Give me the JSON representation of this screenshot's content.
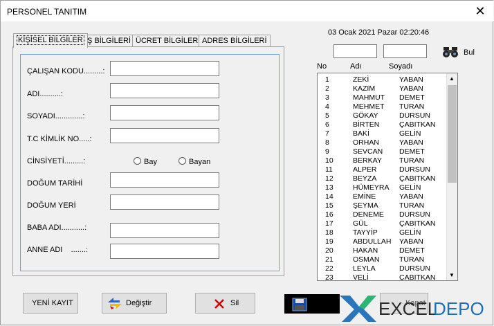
{
  "window": {
    "title": "PERSONEL TANITIM",
    "close_glyph": "✕"
  },
  "tabs": [
    {
      "label": "KİŞİSEL BİLGİLER",
      "active": true
    },
    {
      "label": "İŞ BİLGİLERİ",
      "active": false
    },
    {
      "label": "ÜCRET BİLGİLERİ",
      "active": false
    },
    {
      "label": "ADRES BİLGİLERİ",
      "active": false
    }
  ],
  "form": {
    "calisan_kodu": "ÇALIŞAN KODU.........:",
    "adi": "ADI..........:",
    "soyadi": "SOYADI.............:",
    "tc_kimlik": "T.C KİMLİK NO.....:",
    "cinsiyeti": "CİNSİYETİ.........:",
    "bay": "Bay",
    "bayan": "Bayan",
    "dogum_tarihi": "DOĞUM TARİHİ",
    "dogum_yeri": "DOĞUM YERİ",
    "baba_adi": "BABA ADI...........:",
    "anne_adi": "ANNE ADI    .......:"
  },
  "datetime": "03 Ocak 2021 Pazar 02:20:46",
  "search": {
    "button_label": "Bul"
  },
  "list_headers": {
    "no": "No",
    "adi": "Adı",
    "soyadi": "Soyadı"
  },
  "rows": [
    {
      "no": "1",
      "adi": "ZEKİ",
      "soyadi": "YABAN"
    },
    {
      "no": "2",
      "adi": "KAZIM",
      "soyadi": "YABAN"
    },
    {
      "no": "3",
      "adi": "MAHMUT",
      "soyadi": "DEMET"
    },
    {
      "no": "4",
      "adi": "MEHMET",
      "soyadi": "TURAN"
    },
    {
      "no": "5",
      "adi": "GÖKAY",
      "soyadi": "DURSUN"
    },
    {
      "no": "6",
      "adi": "BİRTEN",
      "soyadi": "ÇABITKAN"
    },
    {
      "no": "7",
      "adi": "BAKİ",
      "soyadi": "GELİN"
    },
    {
      "no": "8",
      "adi": "ORHAN",
      "soyadi": "YABAN"
    },
    {
      "no": "9",
      "adi": "SEVCAN",
      "soyadi": "DEMET"
    },
    {
      "no": "10",
      "adi": "BERKAY",
      "soyadi": "TURAN"
    },
    {
      "no": "11",
      "adi": "ALPER",
      "soyadi": "DURSUN"
    },
    {
      "no": "12",
      "adi": "BEYZA",
      "soyadi": "ÇABITKAN"
    },
    {
      "no": "13",
      "adi": "HÜMEYRA",
      "soyadi": "GELİN"
    },
    {
      "no": "14",
      "adi": "EMİNE",
      "soyadi": "YABAN"
    },
    {
      "no": "15",
      "adi": "ŞEYMA",
      "soyadi": "TURAN"
    },
    {
      "no": "16",
      "adi": "DENEME",
      "soyadi": "DURSUN"
    },
    {
      "no": "17",
      "adi": "GÜL",
      "soyadi": "ÇABITKAN"
    },
    {
      "no": "18",
      "adi": "TAYYİP",
      "soyadi": "GELİN"
    },
    {
      "no": "19",
      "adi": "ABDULLAH",
      "soyadi": "YABAN"
    },
    {
      "no": "20",
      "adi": "HAKAN",
      "soyadi": "DEMET"
    },
    {
      "no": "21",
      "adi": "OSMAN",
      "soyadi": "TURAN"
    },
    {
      "no": "22",
      "adi": "LEYLA",
      "soyadi": "DURSUN"
    },
    {
      "no": "23",
      "adi": "VELİ",
      "soyadi": "ÇABITKAN"
    }
  ],
  "buttons": {
    "yeni_kayit": "YENİ KAYIT",
    "degistir": "Değiştir",
    "sil": "Sil",
    "kapat": "Kapat"
  },
  "watermark": {
    "text": "EXCELDEPO",
    "x_letter": "X",
    "excel": "EXCEL",
    "depo": "DEPO"
  },
  "colors": {
    "accent_border": "#6fa0d6",
    "list_bg": "#ffffff",
    "delete_x": "#d40000",
    "logo_blue": "#1f6fb8",
    "logo_green": "#2bb673"
  }
}
